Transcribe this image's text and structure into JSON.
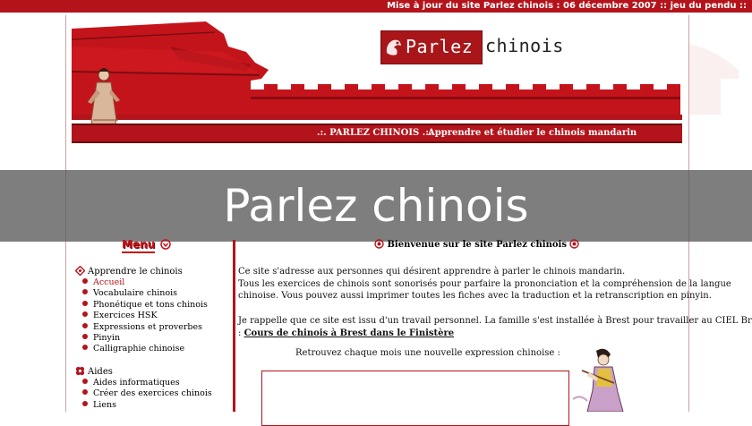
{
  "topbar": {
    "text": "Mise à jour du site  Parlez chinois : 06 décembre 2007 :: jeu du pendu ::"
  },
  "logo": {
    "part1": "Parlez",
    "part2": "chinois"
  },
  "tagline": {
    "left": ".:. PARLEZ CHINOIS  .:.",
    "right": "Apprendre et étudier le chinois mandarin"
  },
  "overlay": {
    "title": "Parlez chinois"
  },
  "menu": {
    "header": "Menu",
    "sections": [
      {
        "title": "Apprendre le chinois",
        "items": [
          "Accueil",
          "Vocabulaire chinois",
          "Phonétique et tons chinois",
          "Exercices HSK",
          "Expressions et proverbes",
          "Pinyin",
          "Calligraphie chinoise"
        ]
      },
      {
        "title": "Aides",
        "items": [
          "Aides informatiques",
          "Créer des exercices chinois",
          "Liens"
        ]
      }
    ]
  },
  "content": {
    "welcome": "Bienvenue sur le site Parlez chinois",
    "p1_line1": "Ce site s'adresse aux personnes qui désirent apprendre à parler le chinois mandarin.",
    "p1_line2": "Tous les exercices de chinois sont sonorisés pour parfaire la prononciation et la compréhension de la langue",
    "p1_line3": "chinoise. Vous pouvez aussi imprimer toutes les fiches avec la traduction et la retranscription en pinyin.",
    "p2_line1": "Je rappelle que ce site est issu d'un travail personnel. La famille s'est installée à Brest pour travailler au CIEL Bretagne",
    "p2_prefix": ":",
    "p2_link": "Cours de chinois à Brest dans le Finistère",
    "monthly": "Retrouvez chaque mois une nouvelle expression chinoise :"
  },
  "colors": {
    "accent": "#b3141b",
    "dark_red": "#6a0a0d",
    "overlay": "#5a5a5a"
  }
}
